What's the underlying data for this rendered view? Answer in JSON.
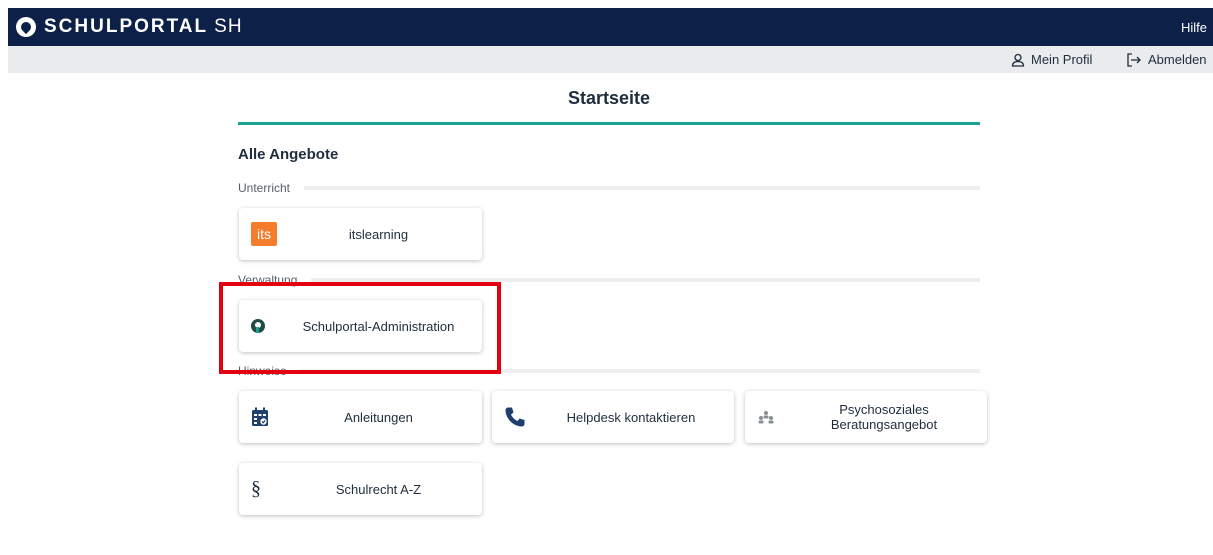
{
  "header": {
    "brand": "SCHULPORTAL",
    "brand_suffix": "SH",
    "help_label": "Hilfe",
    "colors": {
      "primary": "#0d2148",
      "accent": "#1aa393"
    }
  },
  "subnav": {
    "profile_label": "Mein Profil",
    "profile_icon": "user-icon",
    "logout_label": "Abmelden",
    "logout_icon": "logout-icon"
  },
  "main": {
    "title": "Startseite",
    "heading": "Alle Angebote",
    "sections": [
      {
        "label": "Unterricht",
        "tiles": [
          {
            "label": "itslearning",
            "icon": "itslearning-icon",
            "icon_text": "its"
          }
        ]
      },
      {
        "label": "Verwaltung",
        "tiles": [
          {
            "label": "Schulportal-Administration",
            "icon": "schulportal-logo-icon"
          }
        ]
      },
      {
        "label": "Hinweise",
        "tiles": [
          {
            "label": "Anleitungen",
            "icon": "calendar-check-icon"
          },
          {
            "label": "Helpdesk kontaktieren",
            "icon": "phone-icon"
          },
          {
            "label": "Psychosoziales Beratungsangebot",
            "icon": "people-group-icon"
          },
          {
            "label": "Schulrecht A-Z",
            "icon": "paragraph-icon",
            "icon_text": "§"
          }
        ]
      }
    ]
  },
  "annotation": {
    "highlight_color": "#e3000f"
  }
}
